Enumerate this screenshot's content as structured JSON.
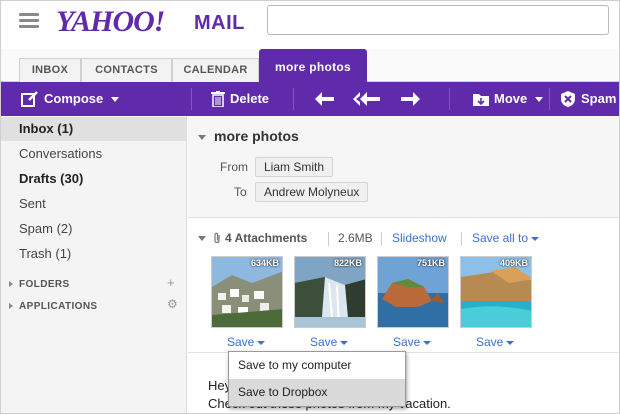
{
  "header": {
    "logo": "YAHOO!",
    "logo_suffix": "MAIL",
    "search_placeholder": ""
  },
  "tabs": [
    {
      "label": "INBOX",
      "active": false
    },
    {
      "label": "CONTACTS",
      "active": false
    },
    {
      "label": "CALENDAR",
      "active": false
    },
    {
      "label": "more photos",
      "active": true
    }
  ],
  "toolbar": {
    "compose": "Compose",
    "delete": "Delete",
    "move": "Move",
    "spam": "Spam"
  },
  "sidebar": {
    "items": [
      {
        "label": "Inbox (1)",
        "bold": true,
        "selected": true
      },
      {
        "label": "Conversations",
        "bold": false
      },
      {
        "label": "Drafts (30)",
        "bold": true
      },
      {
        "label": "Sent",
        "bold": false
      },
      {
        "label": "Spam (2)",
        "bold": false
      },
      {
        "label": "Trash (1)",
        "bold": false
      }
    ],
    "sections": [
      {
        "label": "FOLDERS"
      },
      {
        "label": "APPLICATIONS"
      }
    ]
  },
  "message": {
    "subject": "more photos",
    "from_label": "From",
    "from": "Liam Smith",
    "to_label": "To",
    "to": "Andrew Molyneux",
    "attachments_label": "4 Attachments",
    "total_size": "2.6MB",
    "slideshow": "Slideshow",
    "save_all": "Save all to",
    "attachments": [
      {
        "size": "634KB",
        "save": "Save"
      },
      {
        "size": "822KB",
        "save": "Save"
      },
      {
        "size": "751KB",
        "save": "Save"
      },
      {
        "size": "409KB",
        "save": "Save"
      }
    ],
    "body_line1": "Hey",
    "body_line2": "Check out these photos from my vacation."
  },
  "save_menu": {
    "items": [
      {
        "label": "Save to my computer"
      },
      {
        "label": "Save to Dropbox"
      }
    ]
  },
  "colors": {
    "brand": "#5f2bab",
    "link": "#3b6fd3"
  }
}
